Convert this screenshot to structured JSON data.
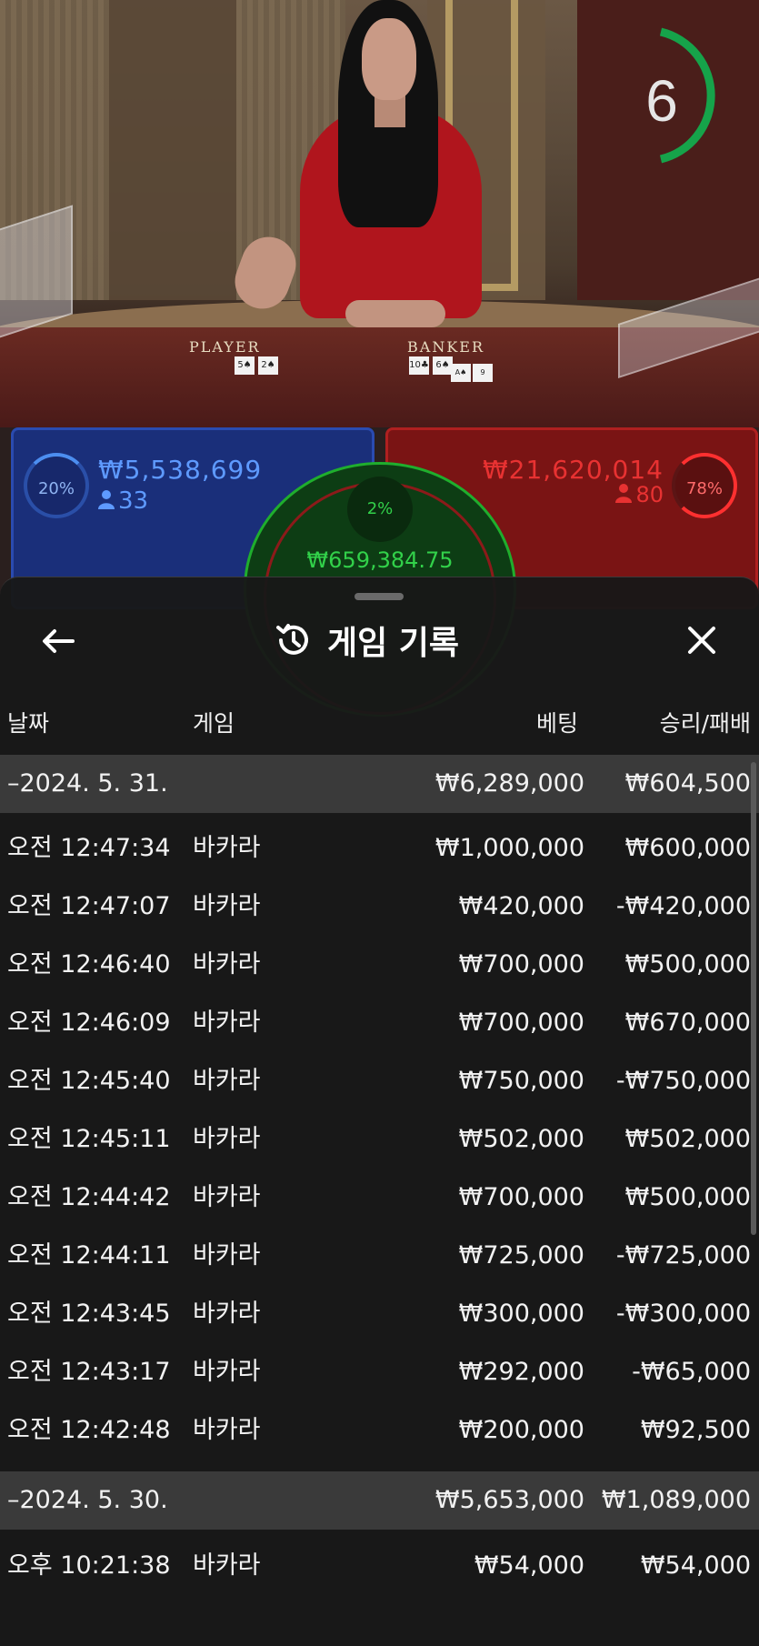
{
  "video": {
    "table_labels": {
      "player": "PLAYER",
      "banker": "BANKER"
    },
    "player_cards": [
      "5♠",
      "2♠"
    ],
    "banker_cards": [
      "10♣",
      "6♠",
      "A♠",
      "9"
    ],
    "countdown": "6"
  },
  "bets": {
    "player": {
      "percent": "20%",
      "amount": "₩5,538,699",
      "players": "33"
    },
    "banker": {
      "percent": "78%",
      "amount": "₩21,620,014",
      "players": "80"
    },
    "tie": {
      "percent": "2%",
      "amount": "₩659,384.75"
    }
  },
  "history": {
    "title": "게임 기록",
    "columns": {
      "date": "날짜",
      "game": "게임",
      "bet": "베팅",
      "result": "승리/패배"
    },
    "groups": [
      {
        "date": "–2024. 5. 31.",
        "bet_total": "₩6,289,000",
        "result_total": "₩604,500",
        "rows": [
          {
            "time": "오전 12:47:34",
            "game": "바카라",
            "bet": "₩1,000,000",
            "result": "₩600,000"
          },
          {
            "time": "오전 12:47:07",
            "game": "바카라",
            "bet": "₩420,000",
            "result": "-₩420,000"
          },
          {
            "time": "오전 12:46:40",
            "game": "바카라",
            "bet": "₩700,000",
            "result": "₩500,000"
          },
          {
            "time": "오전 12:46:09",
            "game": "바카라",
            "bet": "₩700,000",
            "result": "₩670,000"
          },
          {
            "time": "오전 12:45:40",
            "game": "바카라",
            "bet": "₩750,000",
            "result": "-₩750,000"
          },
          {
            "time": "오전 12:45:11",
            "game": "바카라",
            "bet": "₩502,000",
            "result": "₩502,000"
          },
          {
            "time": "오전 12:44:42",
            "game": "바카라",
            "bet": "₩700,000",
            "result": "₩500,000"
          },
          {
            "time": "오전 12:44:11",
            "game": "바카라",
            "bet": "₩725,000",
            "result": "-₩725,000"
          },
          {
            "time": "오전 12:43:45",
            "game": "바카라",
            "bet": "₩300,000",
            "result": "-₩300,000"
          },
          {
            "time": "오전 12:43:17",
            "game": "바카라",
            "bet": "₩292,000",
            "result": "-₩65,000"
          },
          {
            "time": "오전 12:42:48",
            "game": "바카라",
            "bet": "₩200,000",
            "result": "₩92,500"
          }
        ]
      },
      {
        "date": "–2024. 5. 30.",
        "bet_total": "₩5,653,000",
        "result_total": "₩1,089,000",
        "rows": [
          {
            "time": "오후 10:21:38",
            "game": "바카라",
            "bet": "₩54,000",
            "result": "₩54,000"
          }
        ]
      }
    ]
  }
}
